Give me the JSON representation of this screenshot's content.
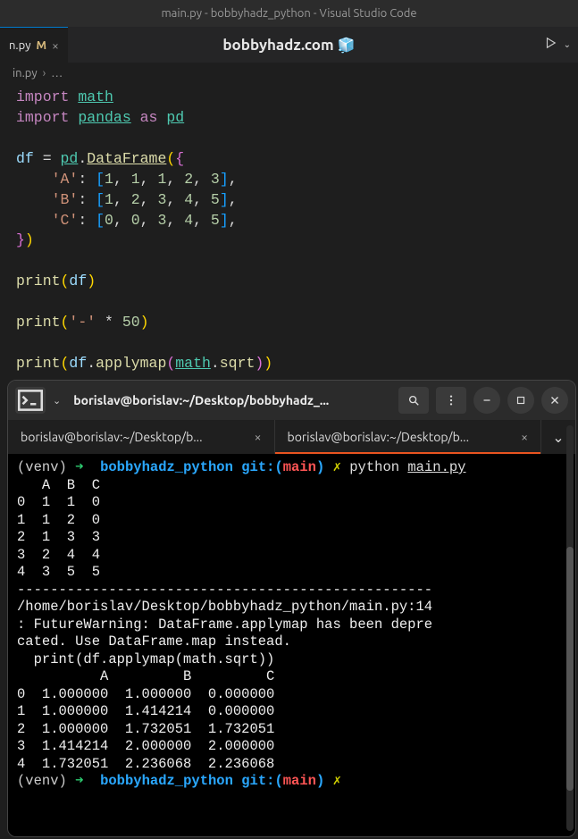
{
  "window": {
    "title": "main.py - bobbyhadz_python - Visual Studio Code"
  },
  "tab": {
    "name": "n.py",
    "modified": "M",
    "close": "×"
  },
  "tabbar": {
    "center_text": "bobbyhadz.com",
    "cube": "🧊"
  },
  "breadcrumb": {
    "file": "in.py",
    "sep": "›",
    "more": "…"
  },
  "code": {
    "import": "import",
    "math": "math",
    "pandas": "pandas",
    "as": "as",
    "pd": "pd",
    "df": "df",
    "eq": "=",
    "DataFrame": "DataFrame",
    "keyA": "'A'",
    "keyB": "'B'",
    "keyC": "'C'",
    "rowA": [
      "1",
      "1",
      "1",
      "2",
      "3"
    ],
    "rowB": [
      "1",
      "2",
      "3",
      "4",
      "5"
    ],
    "rowC": [
      "0",
      "0",
      "3",
      "4",
      "5"
    ],
    "print": "print",
    "dash": "'-'",
    "star": "*",
    "fifty": "50",
    "applymap": "applymap",
    "sqrt": "sqrt",
    "dot": ".",
    "colon": ":",
    "comma": ","
  },
  "terminal": {
    "title": "borislav@borislav:~/Desktop/bobbyhadz_...",
    "app_chevron": "⌄",
    "tabs": [
      {
        "label": "borislav@borislav:~/Desktop/b...",
        "active": false
      },
      {
        "label": "borislav@borislav:~/Desktop/b...",
        "active": true
      }
    ],
    "prompt": {
      "venv": "(venv)",
      "arrow": "➜",
      "dir": "bobbyhadz_python",
      "git": "git:",
      "lp": "(",
      "branch": "main",
      "rp": ")",
      "x": "✗",
      "cmd": "python",
      "file": "main.py"
    },
    "output_header": "   A  B  C",
    "output_rows": [
      "0  1  1  0",
      "1  1  2  0",
      "2  1  3  3",
      "3  2  4  4",
      "4  3  5  5"
    ],
    "separator": "--------------------------------------------------",
    "warning": "/home/borislav/Desktop/bobbyhadz_python/main.py:14: FutureWarning: DataFrame.applymap has been deprecated. Use DataFrame.map instead.\n  print(df.applymap(math.sqrt))",
    "result_header": "          A         B         C",
    "result_rows": [
      "0  1.000000  1.000000  0.000000",
      "1  1.000000  1.414214  0.000000",
      "2  1.000000  1.732051  1.732051",
      "3  1.414214  2.000000  2.000000",
      "4  1.732051  2.236068  2.236068"
    ]
  }
}
